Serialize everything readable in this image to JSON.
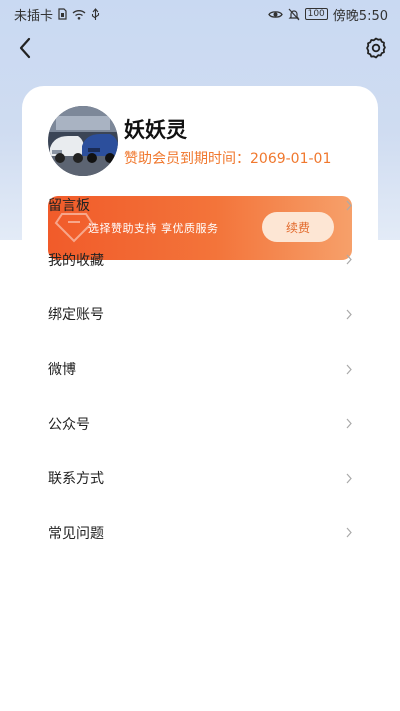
{
  "status_bar": {
    "carrier": "未插卡",
    "battery": "100",
    "time": "傍晚5:50"
  },
  "nav": {
    "back_icon": "chevron-left-icon",
    "settings_icon": "gear-icon"
  },
  "profile": {
    "name": "妖妖灵",
    "membership": "赞助会员到期时间：2069-01-01"
  },
  "vip_banner": {
    "text": "选择赞助支持 享优质服务",
    "button": "续费",
    "colors": {
      "start": "#f15b2a",
      "end": "#f6a06a",
      "accent": "#f0782e"
    }
  },
  "menu": [
    {
      "label": "留言板"
    },
    {
      "label": "我的收藏"
    },
    {
      "label": "绑定账号"
    },
    {
      "label": "微博"
    },
    {
      "label": "公众号"
    },
    {
      "label": "联系方式"
    },
    {
      "label": "常见问题"
    }
  ]
}
